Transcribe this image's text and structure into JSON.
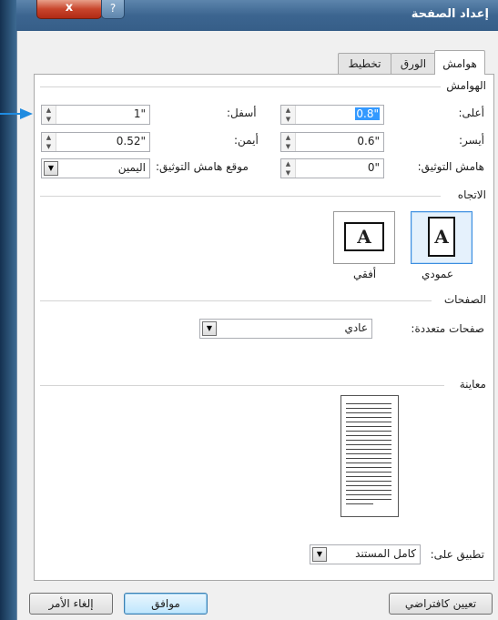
{
  "window": {
    "title": "إعداد الصفحة",
    "close_glyph": "x",
    "help_glyph": "?"
  },
  "tabs": [
    {
      "label": "هوامش"
    },
    {
      "label": "الورق"
    },
    {
      "label": "تخطيط"
    }
  ],
  "margins": {
    "section_title": "الهوامش",
    "top": {
      "label": "أعلى:",
      "value": "0.8\""
    },
    "bottom": {
      "label": "أسفل:",
      "value": "1\""
    },
    "left": {
      "label": "أيسر:",
      "value": "0.6\""
    },
    "right": {
      "label": "أيمن:",
      "value": "0.52\""
    },
    "gutter": {
      "label": "هامش التوثيق:",
      "value": "0\""
    },
    "gutter_position": {
      "label": "موقع هامش التوثيق:",
      "value": "اليمين"
    }
  },
  "orientation": {
    "section_title": "الاتجاه",
    "portrait": {
      "label": "عمودي",
      "glyph": "A",
      "selected": true
    },
    "landscape": {
      "label": "أفقي",
      "glyph": "A",
      "selected": false
    }
  },
  "pages": {
    "section_title": "الصفحات",
    "multiple_label": "صفحات متعددة:",
    "multiple_value": "عادي"
  },
  "preview": {
    "section_title": "معاينة"
  },
  "apply": {
    "label": "تطبيق على:",
    "value": "كامل المستند"
  },
  "buttons": {
    "set_default": "تعيين كافتراضي",
    "ok": "موافق",
    "cancel": "إلغاء الأمر"
  },
  "colors": {
    "accent": "#1f8be0",
    "selection": "#3399ff",
    "titlebar": "#3c6590"
  }
}
